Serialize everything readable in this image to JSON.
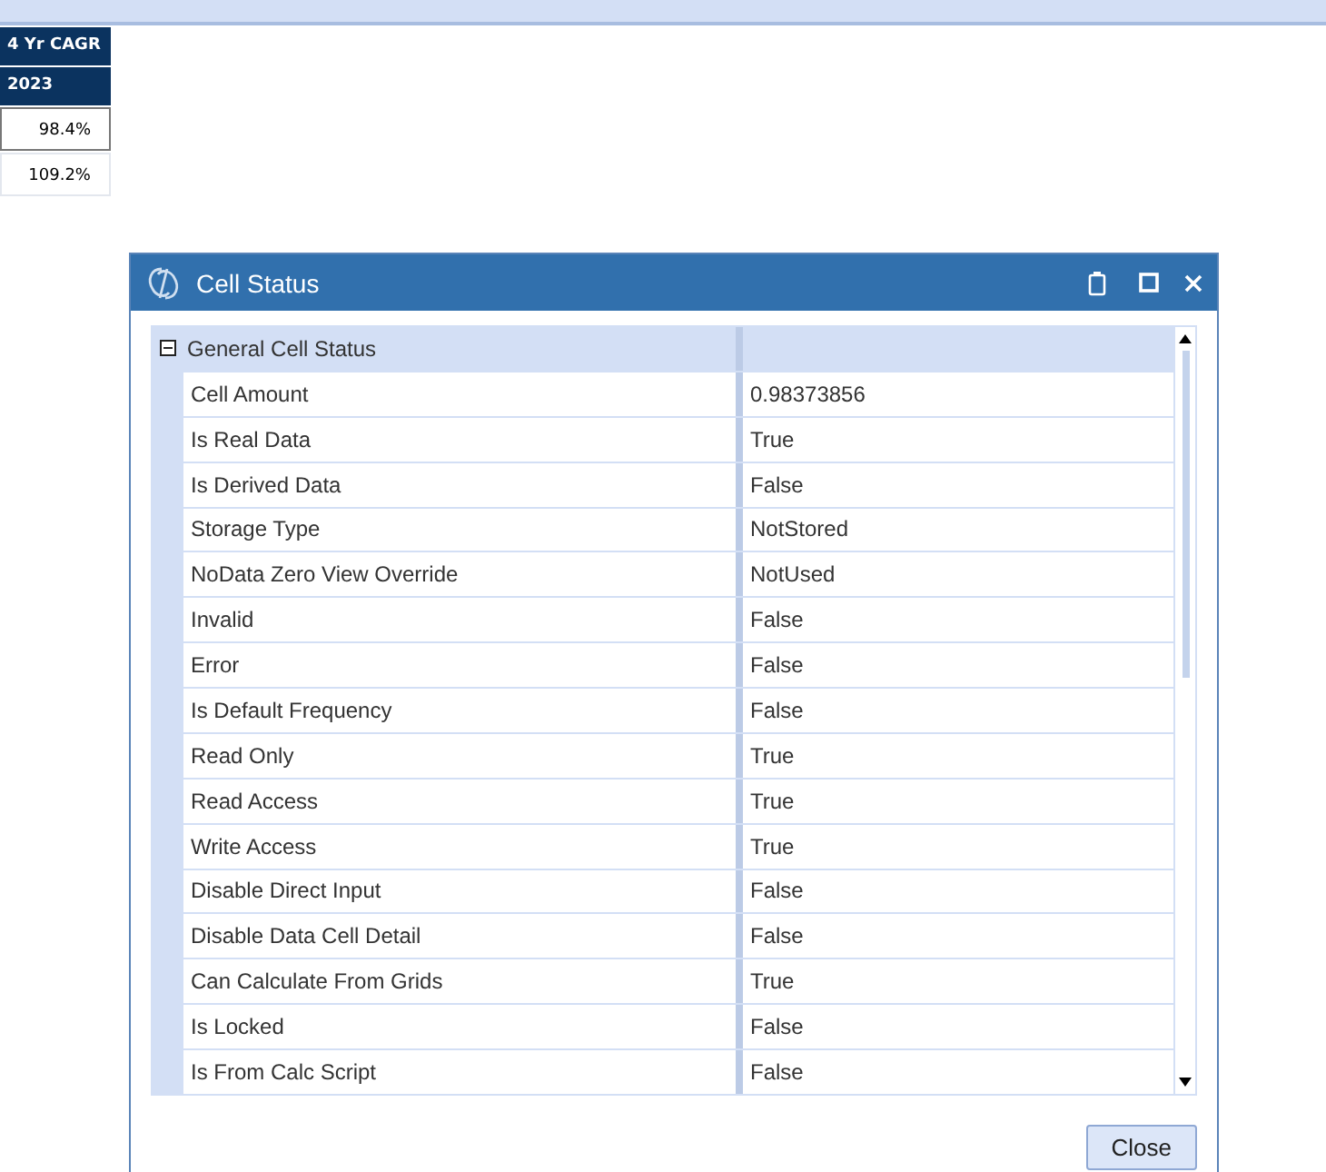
{
  "grid": {
    "headers": [
      "4 Yr CAGR",
      "2023"
    ],
    "cells": [
      {
        "value": "98.4%",
        "selected": true
      },
      {
        "value": "109.2%",
        "selected": false
      }
    ]
  },
  "dialog": {
    "title": "Cell Status",
    "group": {
      "label": "General Cell Status",
      "expanded": true
    },
    "properties": [
      {
        "name": "Cell Amount",
        "value": "0.98373856"
      },
      {
        "name": "Is Real Data",
        "value": "True"
      },
      {
        "name": "Is Derived Data",
        "value": "False"
      },
      {
        "name": "Storage Type",
        "value": "NotStored"
      },
      {
        "name": "NoData Zero View Override",
        "value": "NotUsed"
      },
      {
        "name": "Invalid",
        "value": "False"
      },
      {
        "name": "Error",
        "value": "False"
      },
      {
        "name": "Is Default Frequency",
        "value": "False"
      },
      {
        "name": "Read Only",
        "value": "True"
      },
      {
        "name": "Read Access",
        "value": "True"
      },
      {
        "name": "Write Access",
        "value": "True"
      },
      {
        "name": "Disable Direct Input",
        "value": "False"
      },
      {
        "name": "Disable Data Cell Detail",
        "value": "False"
      },
      {
        "name": "Can Calculate From Grids",
        "value": "True"
      },
      {
        "name": "Is Locked",
        "value": "False"
      },
      {
        "name": "Is From Calc Script",
        "value": "False"
      }
    ],
    "buttons": [
      "Close"
    ]
  }
}
